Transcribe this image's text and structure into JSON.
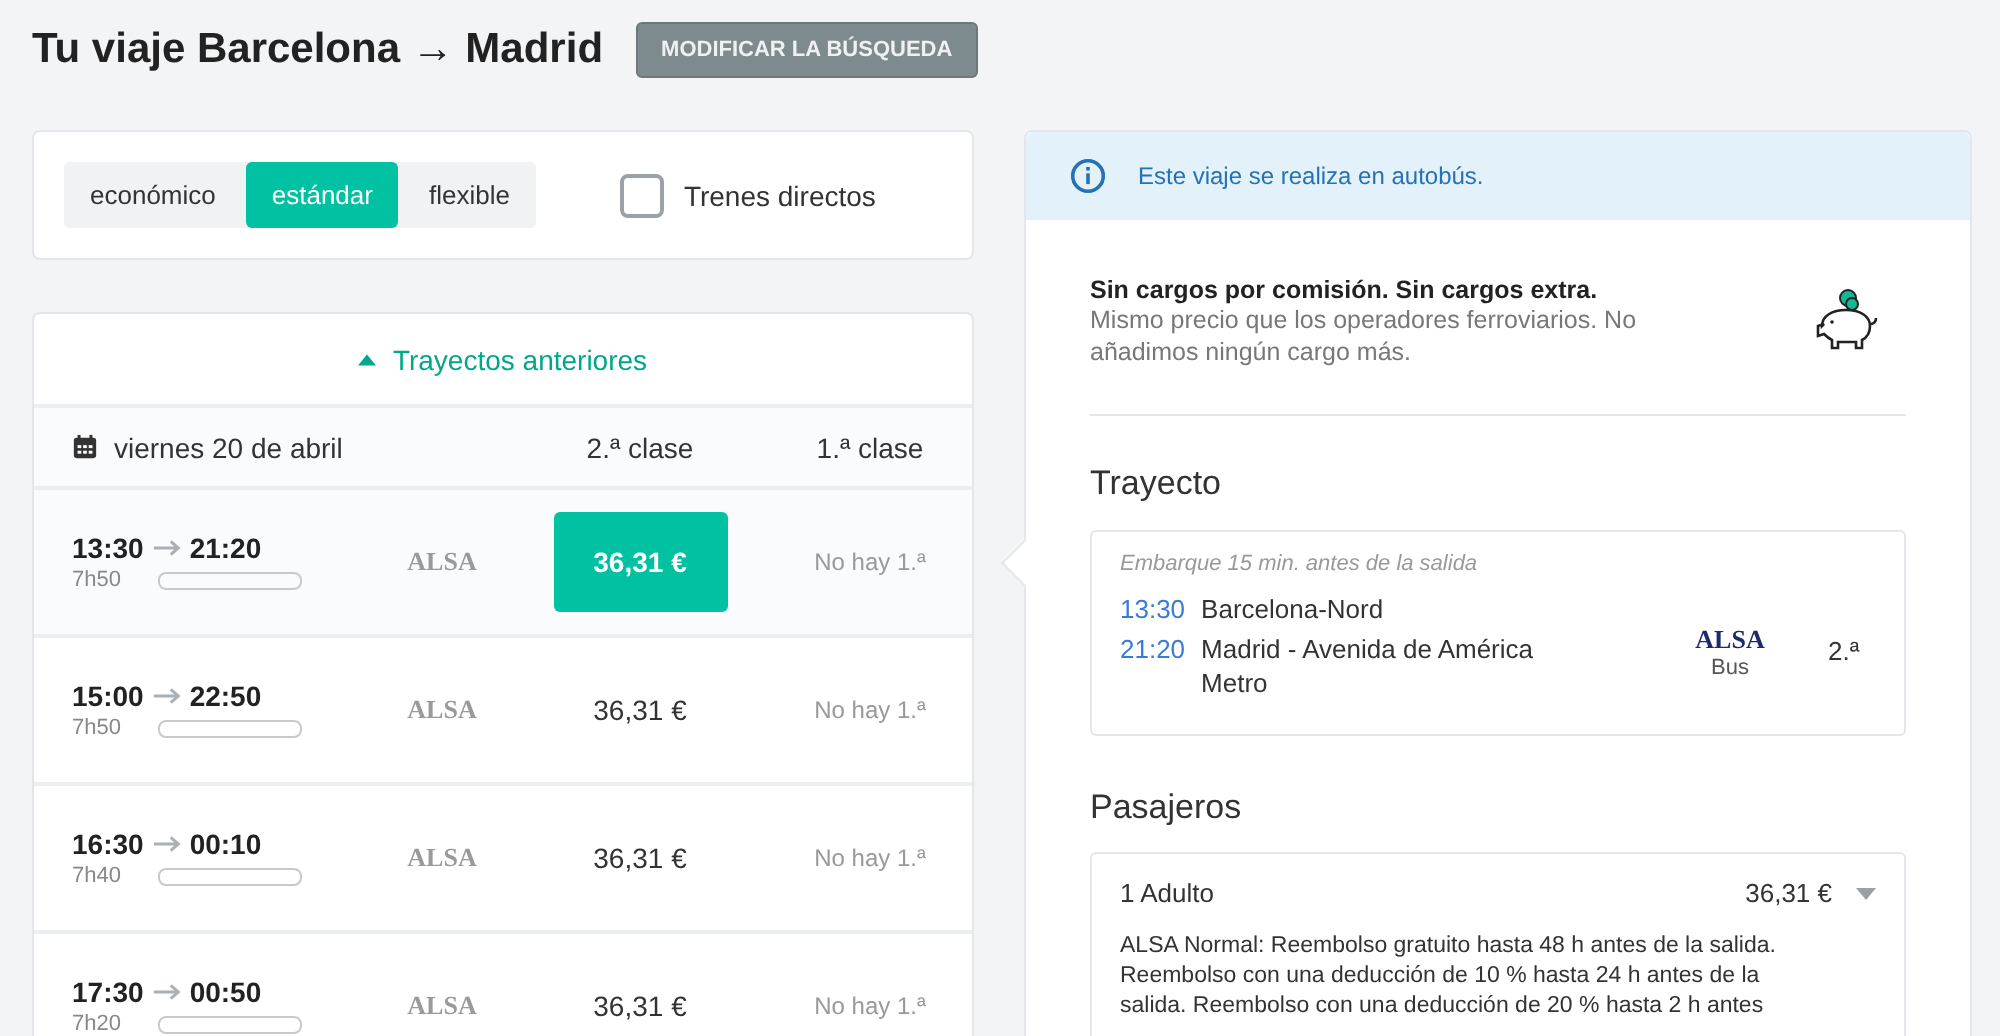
{
  "header": {
    "title": "Tu viaje Barcelona → Madrid",
    "modify_button": "MODIFICAR LA BÚSQUEDA"
  },
  "fare_tabs": [
    {
      "label": "económico",
      "selected": false
    },
    {
      "label": "estándar",
      "selected": true
    },
    {
      "label": "flexible",
      "selected": false
    }
  ],
  "direct_trains": {
    "label": "Trenes directos",
    "checked": false
  },
  "results": {
    "earlier_link": "Trayectos anteriores",
    "date": "viernes 20 de abril",
    "columns": [
      "2.ª clase",
      "1.ª clase"
    ],
    "rows": [
      {
        "departure": "13:30",
        "arrival": "21:20",
        "duration": "7h50",
        "operator": "ALSA",
        "price_2nd": "36,31 €",
        "price_1st": "No hay 1.ª",
        "selected": true
      },
      {
        "departure": "15:00",
        "arrival": "22:50",
        "duration": "7h50",
        "operator": "ALSA",
        "price_2nd": "36,31 €",
        "price_1st": "No hay 1.ª",
        "selected": false
      },
      {
        "departure": "16:30",
        "arrival": "00:10",
        "duration": "7h40",
        "operator": "ALSA",
        "price_2nd": "36,31 €",
        "price_1st": "No hay 1.ª",
        "selected": false
      },
      {
        "departure": "17:30",
        "arrival": "00:50",
        "duration": "7h20",
        "operator": "ALSA",
        "price_2nd": "36,31 €",
        "price_1st": "No hay 1.ª",
        "selected": false
      }
    ]
  },
  "details": {
    "notice": "Este viaje se realiza en autobús.",
    "fees": {
      "title": "Sin cargos por comisión. Sin cargos extra.",
      "text": "Mismo precio que los operadores ferroviarios. No añadimos ningún cargo más."
    },
    "journey": {
      "heading": "Trayecto",
      "boarding_note": "Embarque 15 min. antes de la salida",
      "stops": [
        {
          "time": "13:30",
          "station": "Barcelona-Nord"
        },
        {
          "time": "21:20",
          "station": "Madrid - Avenida de América Metro"
        }
      ],
      "operator": "ALSA",
      "mode": "Bus",
      "class": "2.ª"
    },
    "passengers": {
      "heading": "Pasajeros",
      "items": [
        {
          "label": "1 Adulto",
          "price": "36,31 €",
          "expanded": true,
          "policy_lines": [
            "ALSA Normal: Reembolso gratuito hasta 48 h antes de la salida.",
            "Reembolso con una deducción de 10 % hasta 24 h antes de la",
            "salida. Reembolso con una deducción de 20 % hasta 2 h antes"
          ]
        }
      ]
    }
  }
}
